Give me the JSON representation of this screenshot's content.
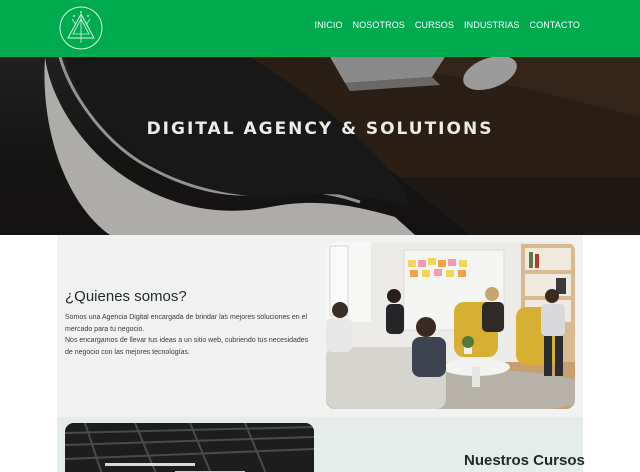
{
  "nav": {
    "links": [
      "INICIO",
      "NOSOTROS",
      "CURSOS",
      "INDUSTRIAS",
      "CONTACTO"
    ]
  },
  "hero": {
    "title": "DIGITAL AGENCY & SOLUTIONS"
  },
  "about": {
    "heading": "¿Quienes somos?",
    "paragraph1": "Somos una Agencia Digital encargada de brindar las mejores soluciones en el mercado para tu negocio.",
    "paragraph2": "Nos encargamos de llevar tus ideas a un sitio web, cubriendo tus necesidades de negocio con las mejores tecnologías."
  },
  "courses": {
    "heading": "Nuestros Cursos"
  },
  "colors": {
    "brand_green": "#00aa4e",
    "about_bg": "#f3f2f2",
    "courses_bg": "#e5ecea"
  }
}
